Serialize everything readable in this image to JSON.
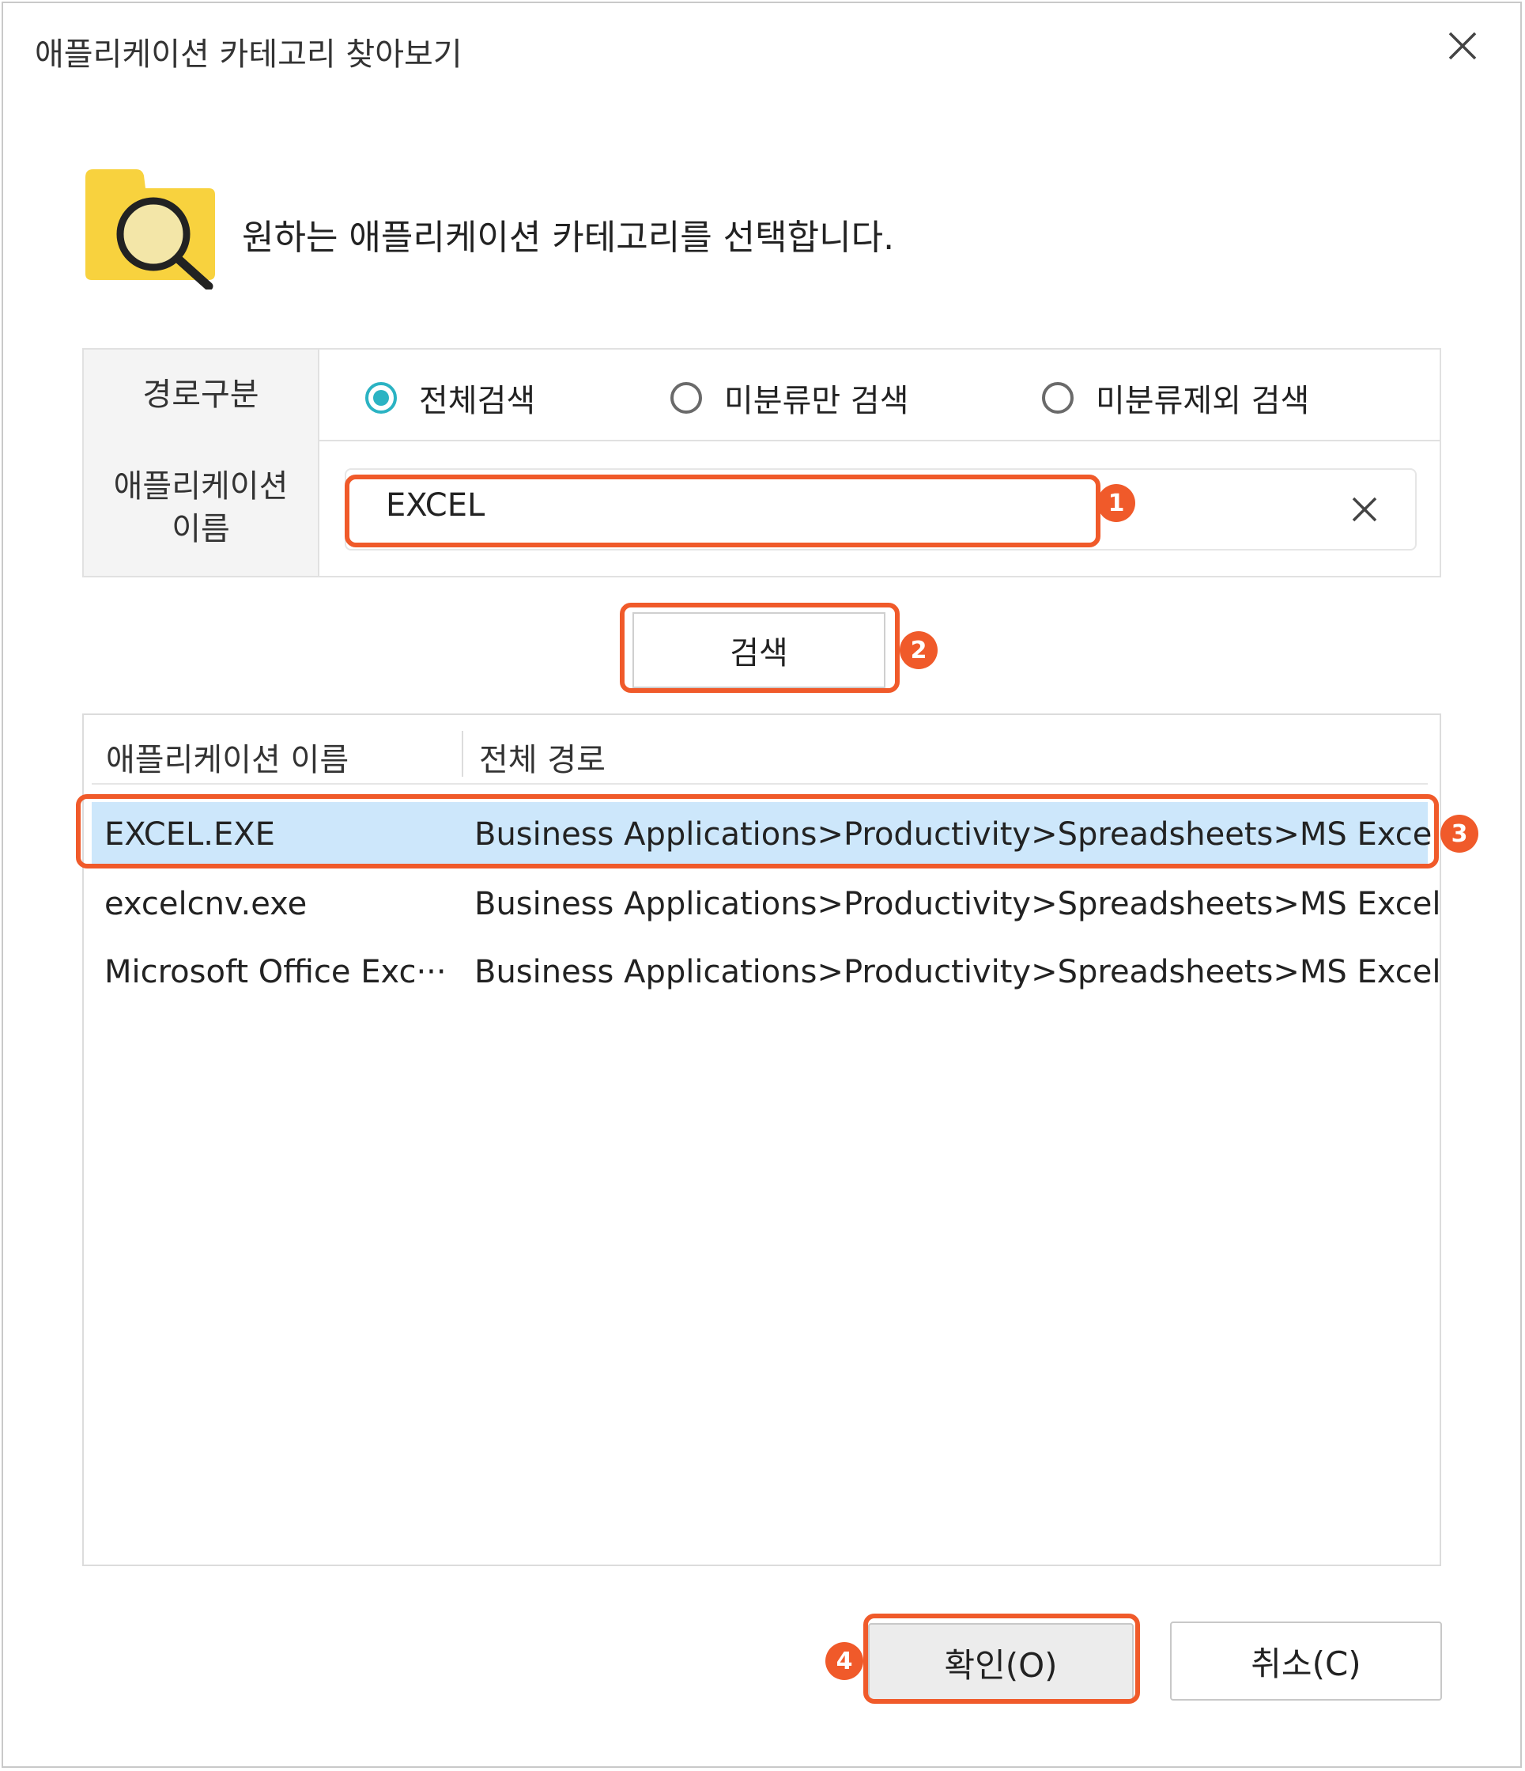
{
  "window": {
    "title": "애플리케이션 카테고리 찾아보기"
  },
  "header": {
    "text": "원하는 애플리케이션 카테고리를 선택합니다."
  },
  "form": {
    "path_label": "경로구분",
    "radios": [
      "전체검색",
      "미분류만 검색",
      "미분류제외 검색"
    ],
    "selected_radio": "전체검색",
    "name_label_line1": "애플리케이션",
    "name_label_line2": "이름",
    "name_value": "EXCEL"
  },
  "search_button": "검색",
  "list": {
    "columns": [
      "애플리케이션 이름",
      "전체 경로"
    ],
    "rows": [
      {
        "name": "EXCEL.EXE",
        "path": "Business Applications>Productivity>Spreadsheets>MS Excel"
      },
      {
        "name": "excelcnv.exe",
        "path": "Business Applications>Productivity>Spreadsheets>MS Excel"
      },
      {
        "name": "Microsoft Office Exc···",
        "path": "Business Applications>Productivity>Spreadsheets>MS Excel"
      }
    ],
    "selected_row": "EXCEL.EXE"
  },
  "buttons": {
    "ok": "확인(O)",
    "cancel": "취소(C)"
  },
  "annotations": [
    "1",
    "2",
    "3",
    "4"
  ],
  "colors": {
    "accent": "#2bb3c3",
    "annotation": "#f05a2a",
    "selection": "#cde7fb",
    "folder": "#f8d23e"
  }
}
